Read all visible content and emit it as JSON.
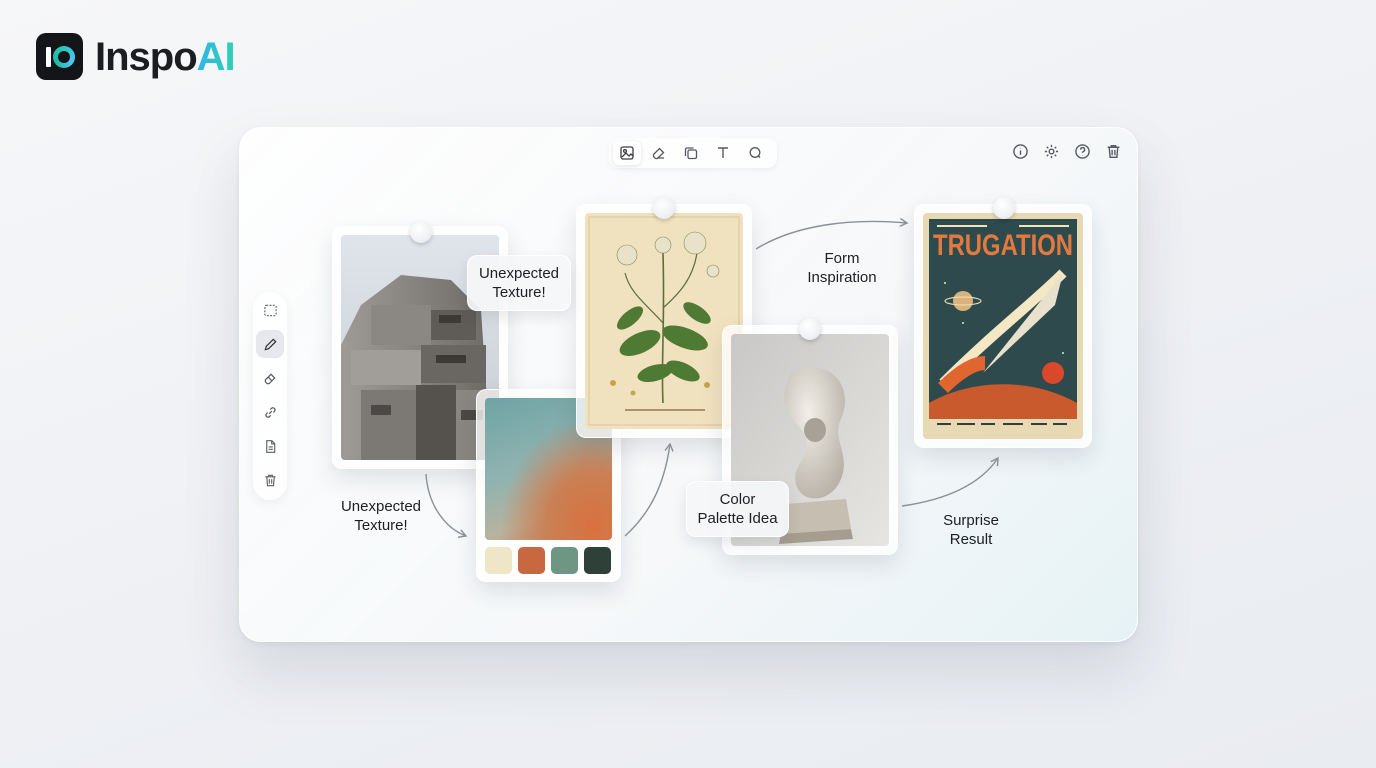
{
  "app": {
    "logo_text_primary": "Inspo",
    "logo_text_accent": "AI",
    "logo_icon": "inspoai-logo-icon"
  },
  "toolbar": {
    "tools": [
      {
        "icon": "image-collage-icon",
        "active": true
      },
      {
        "icon": "eraser-icon",
        "active": false
      },
      {
        "icon": "copy-icon",
        "active": false
      },
      {
        "icon": "text-icon",
        "active": false
      },
      {
        "icon": "lasso-icon",
        "active": false
      }
    ],
    "right": [
      {
        "icon": "info-icon"
      },
      {
        "icon": "gear-icon"
      },
      {
        "icon": "help-icon"
      },
      {
        "icon": "trash-icon"
      }
    ]
  },
  "sidebar": {
    "tools": [
      {
        "icon": "marquee-select-icon",
        "active": false
      },
      {
        "icon": "pencil-icon",
        "active": true
      },
      {
        "icon": "eraser-icon",
        "active": false
      },
      {
        "icon": "link-icon",
        "active": false
      },
      {
        "icon": "document-icon",
        "active": false
      },
      {
        "icon": "trash-icon",
        "active": false
      }
    ]
  },
  "cards": {
    "architecture": {
      "subject": "brutalist concrete building"
    },
    "palette": {
      "swatches": [
        "#efe6c8",
        "#c86840",
        "#6e9783",
        "#2e4037"
      ]
    },
    "botanical": {
      "subject": "botanical flower illustration"
    },
    "sculpture": {
      "subject": "abstract stone sculpture"
    },
    "poster": {
      "title": "TRUGATION",
      "subject": "retro rocket space poster"
    }
  },
  "labels": {
    "bubble_texture_top": "Unexpected Texture!",
    "texture_bottom": "Unexpected Texture!",
    "form_inspiration": "Form Inspiration",
    "color_palette_idea": "Color Palette Idea",
    "surprise_result": "Surprise Result"
  },
  "colors": {
    "accent_gradient_start": "#2fb6e8",
    "accent_gradient_end": "#2fd0b0",
    "arrow": "#8a9096"
  }
}
